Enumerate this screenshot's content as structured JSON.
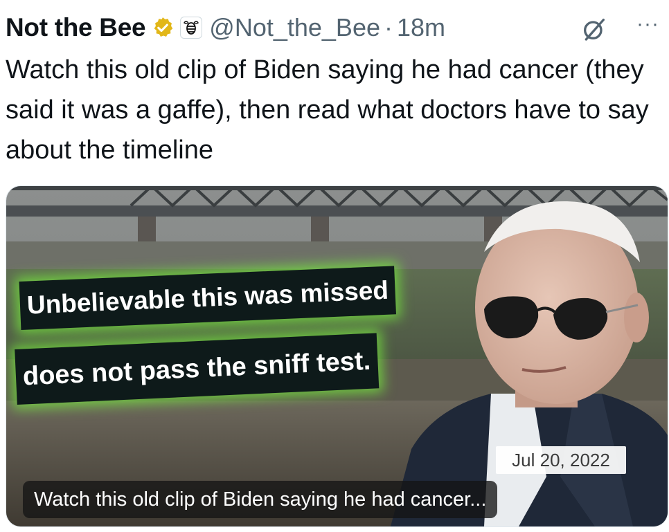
{
  "tweet": {
    "author_name": "Not the Bee",
    "handle": "@Not_the_Bee",
    "separator": "·",
    "time": "18m",
    "more_label": "···",
    "text": "Watch this old clip of Biden saying he had cancer (they said it was a gaffe), then read what doctors have to say about the timeline",
    "verified_badge_color": "#e2b719",
    "icons": [
      "verified-badge-icon",
      "babylon-bee-affiliate-icon",
      "grok-icon",
      "more-options-icon"
    ]
  },
  "media": {
    "overlay_line_1": "Unbelievable this was missed",
    "overlay_line_2": "does not pass the sniff test.",
    "date_stamp": "Jul 20, 2022",
    "caption": "Watch this old clip of Biden saying he had cancer..."
  }
}
